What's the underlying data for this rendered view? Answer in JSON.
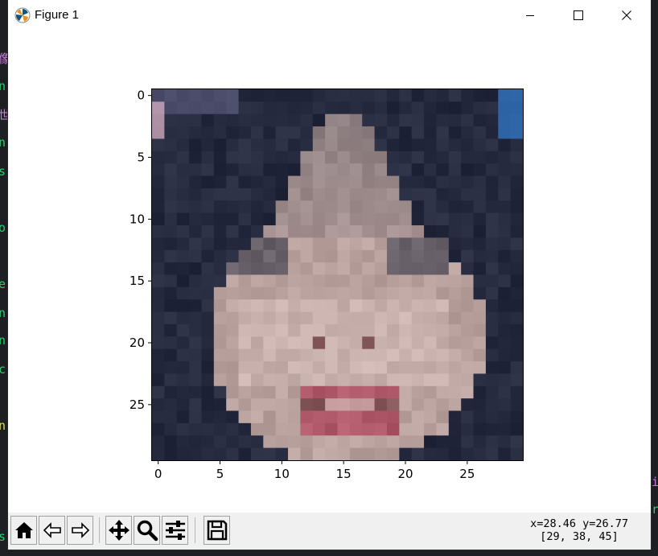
{
  "window": {
    "title": "Figure 1",
    "minimize_icon": "minimize-icon",
    "maximize_icon": "maximize-icon",
    "close_icon": "close-icon"
  },
  "toolbar": {
    "buttons": [
      {
        "name": "home-button",
        "icon": "home-icon"
      },
      {
        "name": "back-button",
        "icon": "back-arrow-icon"
      },
      {
        "name": "forward-button",
        "icon": "forward-arrow-icon"
      },
      {
        "name": "pan-button",
        "icon": "move-icon"
      },
      {
        "name": "zoom-button",
        "icon": "zoom-icon"
      },
      {
        "name": "configure-subplots-button",
        "icon": "sliders-icon"
      },
      {
        "name": "save-button",
        "icon": "floppy-disk-icon"
      }
    ],
    "coords_line1": "x=28.46 y=26.77",
    "coords_line2": "[29, 38, 45]"
  },
  "chart_data": {
    "type": "heatmap",
    "description_kind": "imshow",
    "xlim": [
      -0.5,
      29.5
    ],
    "ylim": [
      29.5,
      -0.5
    ],
    "x_ticks": [
      0,
      5,
      10,
      15,
      20,
      25
    ],
    "y_ticks": [
      0,
      5,
      10,
      15,
      20,
      25
    ],
    "x_tick_labels": [
      "0",
      "5",
      "10",
      "15",
      "20",
      "25"
    ],
    "y_tick_labels": [
      "0",
      "5",
      "10",
      "15",
      "20",
      "25"
    ],
    "grid": false,
    "colors": {
      "hair": "#262a3e",
      "skin": "#b9a29e",
      "skin_light": "#c9b2ae",
      "lips": "#b0596a",
      "mouth_dark": "#6e3a40",
      "background_corner": "#2f6fb8"
    }
  },
  "gutter": {
    "left": [
      "像",
      "n",
      "世",
      "n",
      "s",
      "o",
      "e",
      "n",
      "n",
      "c",
      "n",
      "s"
    ],
    "right": [
      "i",
      "r"
    ]
  }
}
